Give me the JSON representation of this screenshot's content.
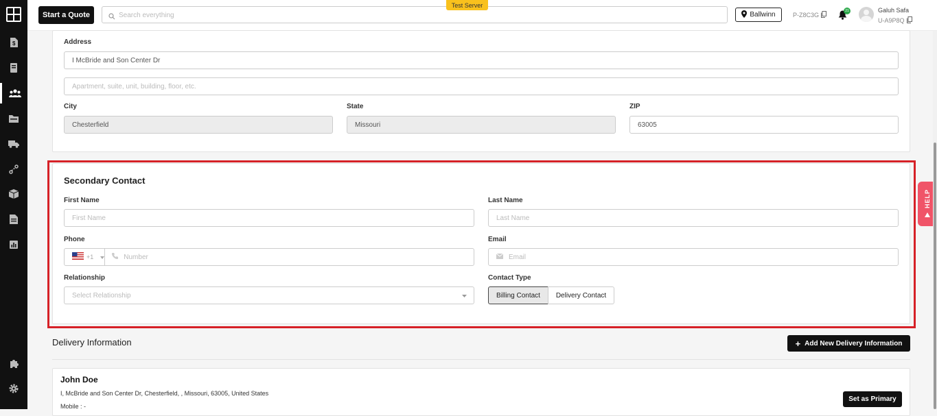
{
  "header": {
    "quote_button": "Start a Quote",
    "search_placeholder": "Search everything",
    "server_badge": "Test Server",
    "location": "Ballwinn",
    "project_code": "P-Z8C3G",
    "notification_count": "21",
    "user_name": "Galuh Safa",
    "user_code": "U-A9P8Q"
  },
  "address": {
    "label": "Address",
    "line1": "I McBride and Son Center Dr",
    "line2_placeholder": "Apartment, suite, unit, building, floor, etc.",
    "city_label": "City",
    "city": "Chesterfield",
    "state_label": "State",
    "state": "Missouri",
    "zip_label": "ZIP",
    "zip": "63005"
  },
  "secondary_contact": {
    "title": "Secondary Contact",
    "first_name_label": "First Name",
    "first_name_placeholder": "First Name",
    "last_name_label": "Last Name",
    "last_name_placeholder": "Last Name",
    "phone_label": "Phone",
    "country_code": "+1",
    "phone_placeholder": "Number",
    "email_label": "Email",
    "email_placeholder": "Email",
    "relationship_label": "Relationship",
    "relationship_placeholder": "Select Relationship",
    "contact_type_label": "Contact Type",
    "contact_types": [
      "Billing Contact",
      "Delivery Contact"
    ]
  },
  "delivery": {
    "title": "Delivery Information",
    "add_button": "Add New Delivery Information",
    "entry": {
      "name": "John Doe",
      "address": "I, McBride and Son Center Dr, Chesterfield, , Missouri, 63005, United States",
      "mobile": "Mobile : -",
      "primary_button": "Set as Primary"
    }
  },
  "help_tab": "HELP",
  "colors": {
    "highlight": "#d62127",
    "badge": "#f9c11d",
    "help": "#f05468",
    "notification": "#2ca84a"
  }
}
